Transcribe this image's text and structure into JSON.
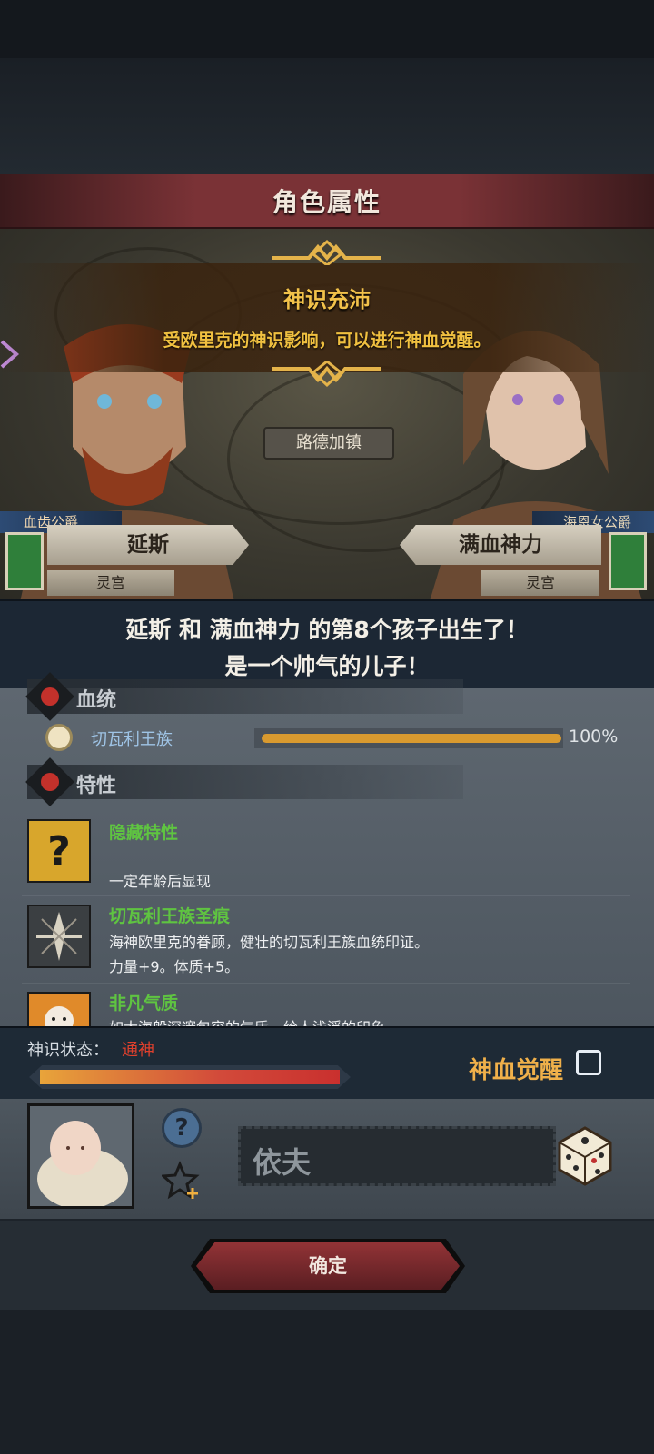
{
  "dialog": {
    "title": "角色属性"
  },
  "banner": {
    "title": "神识充沛",
    "subtitle": "受欧里克的神识影响，可以进行神血觉醒。"
  },
  "map": {
    "town_label": "路德加镇"
  },
  "father": {
    "title": "血齿公爵",
    "name": "延斯",
    "subtitle": "灵宫"
  },
  "mother": {
    "title": "海恩女公爵",
    "name": "满血神力",
    "subtitle": "灵宫"
  },
  "birth": {
    "line1": "延斯 和 满血神力 的第8个孩子出生了！",
    "line2": "是一个帅气的儿子！"
  },
  "bloodline": {
    "section_title": "血统",
    "name": "切瓦利王族",
    "percent_text": "100%",
    "percent": 100
  },
  "traits": {
    "section_title": "特性",
    "items": [
      {
        "name": "隐藏特性",
        "desc1": "",
        "desc2": "一定年龄后显现"
      },
      {
        "name": "切瓦利王族圣痕",
        "desc1": "海神欧里克的眷顾，健壮的切瓦利王族血统印证。",
        "desc2": "力量+9。体质+5。"
      },
      {
        "name": "非凡气质",
        "desc1": "如大海般深邃包容的气质，给人浅浮的印象",
        "desc2": ""
      }
    ]
  },
  "status": {
    "label": "神识状态：",
    "value": "通神",
    "fill": 1.0
  },
  "awaken": {
    "label": "神血觉醒",
    "checked": false
  },
  "child": {
    "name": "依夫"
  },
  "confirm": {
    "label": "确定"
  },
  "colors": {
    "accent_gold": "#f2c24a",
    "trait_green": "#5fc441",
    "status_red": "#e0402d",
    "header_red": "#7a3236"
  }
}
